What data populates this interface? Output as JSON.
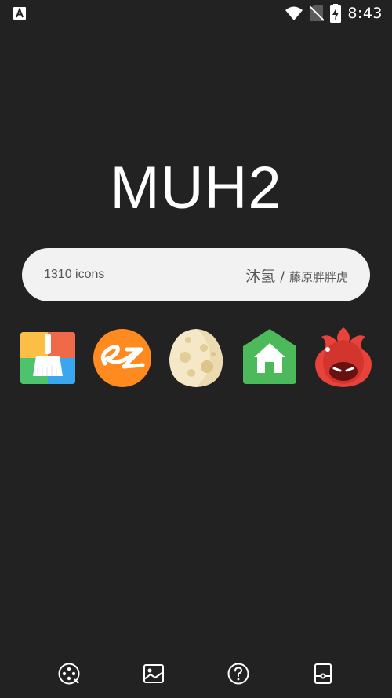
{
  "status_bar": {
    "time": "8:43",
    "icons": [
      "a-notification-icon",
      "wifi-icon",
      "no-sim-icon",
      "battery-charging-icon"
    ]
  },
  "app": {
    "title": "MUH2"
  },
  "info_pill": {
    "icon_count": "1310 icons",
    "author_primary": "沐氢",
    "separator": "/",
    "author_secondary": "藤原胖胖虎"
  },
  "preview_icons": [
    {
      "name": "cleaner-icon"
    },
    {
      "name": "alibaba-icon"
    },
    {
      "name": "egg-icon"
    },
    {
      "name": "home-icon"
    },
    {
      "name": "antutu-icon"
    }
  ],
  "bottom_nav": [
    {
      "name": "icon-pack-icon"
    },
    {
      "name": "wallpaper-icon"
    },
    {
      "name": "help-icon"
    },
    {
      "name": "apply-icon"
    }
  ],
  "colors": {
    "background": "#222222",
    "pill": "#f2f2f2",
    "text_dark": "#555555"
  }
}
